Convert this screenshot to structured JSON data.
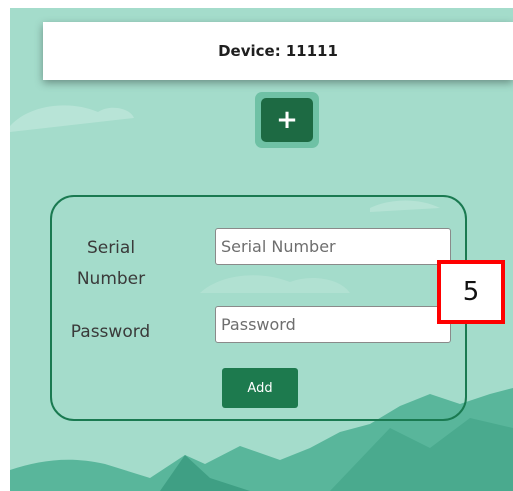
{
  "header": {
    "device_label": "Device:",
    "device_id": "11111"
  },
  "add_device": {
    "icon": "plus-icon",
    "glyph": "+"
  },
  "form": {
    "serial_label": "Serial Number",
    "serial_placeholder": "Serial Number",
    "serial_value": "",
    "password_label": "Password",
    "password_placeholder": "Password",
    "password_value": "",
    "add_label": "Add"
  },
  "annotation": {
    "step_number": "5"
  },
  "colors": {
    "background": "#a4dccb",
    "primary_green": "#1d6a43",
    "panel_border": "#1a7a51",
    "annotation_red": "#ff0000"
  }
}
